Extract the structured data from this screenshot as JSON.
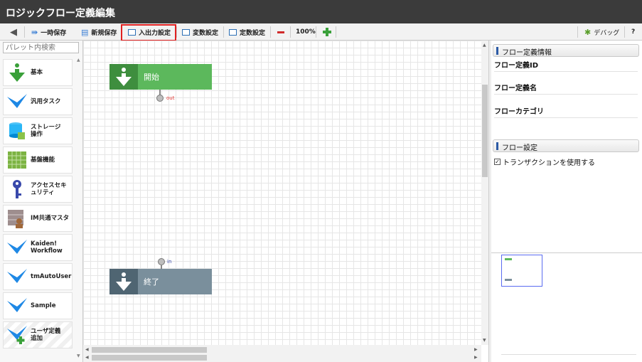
{
  "window": {
    "title": "ロジックフロー定義編集"
  },
  "toolbar": {
    "back_icon": "arrow-left-icon",
    "temp_save": "一時保存",
    "new_save": "新規保存",
    "io_settings": "入出力設定",
    "variable_settings": "変数設定",
    "constant_settings": "定数設定",
    "zoom": "100%",
    "debug": "デバッグ",
    "help": "?"
  },
  "palette": {
    "search_placeholder": "パレット内検索",
    "items": [
      {
        "label": "基本",
        "icon": "basic-arrow-icon"
      },
      {
        "label": "汎用タスク",
        "icon": "generic-task-icon"
      },
      {
        "label": "ストレージ操作",
        "icon": "storage-icon"
      },
      {
        "label": "基盤機能",
        "icon": "platform-grid-icon"
      },
      {
        "label": "アクセスセキュリティ",
        "icon": "key-icon"
      },
      {
        "label": "IM共通マスタ",
        "icon": "database-user-icon"
      },
      {
        "label": "Kaiden! Workflow",
        "icon": "kaiden-arrow-icon"
      },
      {
        "label": "tmAutoUser",
        "icon": "tmautouser-arrow-icon"
      },
      {
        "label": "Sample",
        "icon": "sample-arrow-icon"
      },
      {
        "label": "ユーザ定義追加",
        "icon": "user-defined-add-icon"
      }
    ]
  },
  "canvas": {
    "start_node": {
      "label": "開始",
      "port": "out"
    },
    "end_node": {
      "label": "終了",
      "port": "in"
    }
  },
  "properties": {
    "flow_info_header": "フロー定義情報",
    "flow_id_label": "フロー定義ID",
    "flow_name_label": "フロー定義名",
    "flow_category_label": "フローカテゴリ",
    "flow_settings_header": "フロー設定",
    "use_transaction_label": "トランザクションを使用する",
    "use_transaction_checked": true
  },
  "colors": {
    "start_node": "#5cb85c",
    "start_node_icon": "#3e8e3e",
    "end_node": "#7a8f9c",
    "end_node_icon": "#4f6572",
    "highlight": "#e02020",
    "blue_arrow": "#1e88e5"
  }
}
